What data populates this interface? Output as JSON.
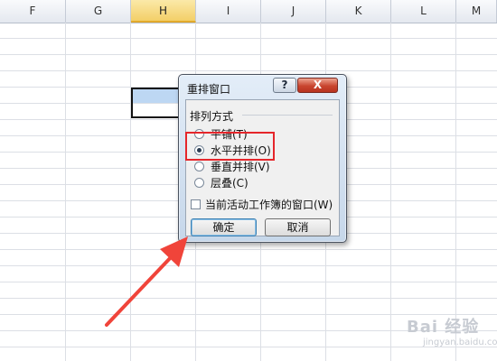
{
  "spreadsheet": {
    "columns": [
      "F",
      "G",
      "H",
      "I",
      "J",
      "K",
      "L",
      "M"
    ],
    "selected_column": "H"
  },
  "dialog": {
    "title": "重排窗口",
    "help_label": "?",
    "close_label": "X",
    "group_label": "排列方式",
    "options": [
      {
        "label": "平铺(T)",
        "selected": false
      },
      {
        "label": "水平并排(O)",
        "selected": true
      },
      {
        "label": "垂直并排(V)",
        "selected": false
      },
      {
        "label": "层叠(C)",
        "selected": false
      }
    ],
    "checkbox_label": "当前活动工作簿的窗口(W)",
    "checkbox_checked": false,
    "ok_label": "确定",
    "cancel_label": "取消"
  },
  "annotation": {
    "highlight_color": "#e5262b",
    "arrow_color": "#f0443a"
  },
  "watermark": {
    "text": "Bai 经验",
    "sub": "jingyan.baidu.com"
  }
}
